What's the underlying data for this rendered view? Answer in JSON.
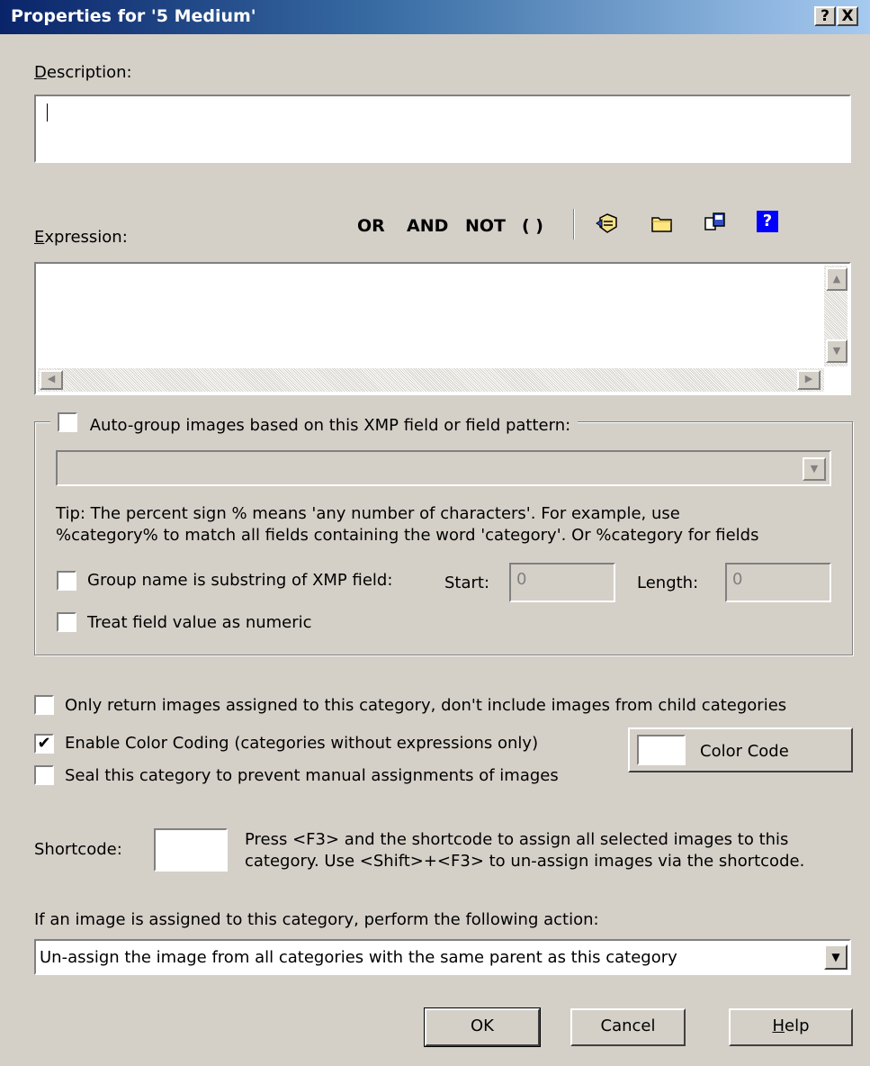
{
  "window": {
    "title": "Properties for '5 Medium'",
    "help_btn": "?",
    "close_btn": "X"
  },
  "description": {
    "label": "Description:",
    "value": ""
  },
  "expression": {
    "label": "Expression:",
    "ops": [
      "OR",
      "AND",
      "NOT",
      "( )"
    ],
    "icons": [
      "edit-expression-icon",
      "folder-icon",
      "copy-icon",
      "help-icon"
    ],
    "value": ""
  },
  "autogroup": {
    "checkbox_label": "Auto-group images based on this XMP field or field pattern:",
    "checked": false,
    "field_value": "",
    "tip_line1": "Tip: The percent sign % means 'any number of characters'. For example, use",
    "tip_line2": "%category% to match all fields containing the word 'category'. Or %category for fields",
    "substring_label": "Group name is substring of XMP field:",
    "start_label": "Start:",
    "start_value": "0",
    "length_label": "Length:",
    "length_value": "0",
    "numeric_label": "Treat field value as numeric"
  },
  "options": {
    "only_return_label": "Only return images assigned to this category, don't include images from child categories",
    "only_return_checked": false,
    "color_coding_label": "Enable Color Coding (categories without expressions only)",
    "color_coding_checked": true,
    "check_mark": "✔",
    "seal_label": "Seal this category to prevent manual assignments of images",
    "seal_checked": false,
    "color_code_button": "Color Code",
    "color_swatch": "#ffffff"
  },
  "shortcode": {
    "label": "Shortcode:",
    "value": "",
    "help_line1": "Press <F3> and the shortcode to assign all selected images to this",
    "help_line2": "category. Use <Shift>+<F3> to un-assign images via the shortcode."
  },
  "action": {
    "label": "If an image is assigned to this category, perform the following action:",
    "selected": "Un-assign the image from all categories with the same parent as this category"
  },
  "buttons": {
    "ok": "OK",
    "cancel": "Cancel",
    "help": "Help"
  }
}
